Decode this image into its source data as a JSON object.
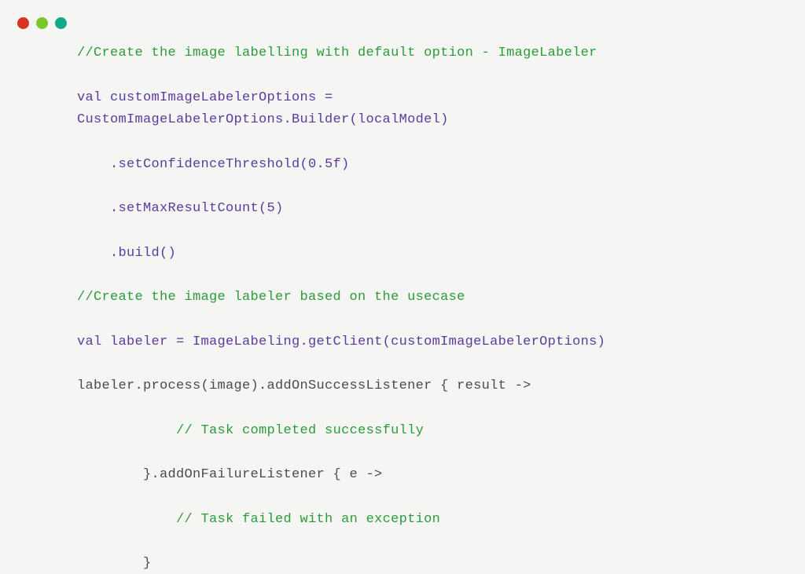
{
  "window": {
    "dots": [
      "red",
      "yellow",
      "green"
    ]
  },
  "code": {
    "line1_comment": "//Create the image labelling with default option - ImageLabeler",
    "line2_val": "val",
    "line2_decl": " customImageLabelerOptions =",
    "line3": "CustomImageLabelerOptions.Builder(localModel)",
    "line4": "    .setConfidenceThreshold(0.5f)",
    "line5": "    .setMaxResultCount(5)",
    "line6": "    .build()",
    "line7_comment": "//Create the image labeler based on the usecase",
    "line8_val": "val",
    "line8_rest": " labeler = ImageLabeling.getClient(customImageLabelerOptions)",
    "line9": "labeler.process(image).addOnSuccessListener { result ->",
    "line10_indent": "            ",
    "line10_comment": "// Task completed successfully",
    "line11": "        }.addOnFailureListener { e ->",
    "line12_indent": "            ",
    "line12_comment": "// Task failed with an exception",
    "line13": "        }"
  }
}
